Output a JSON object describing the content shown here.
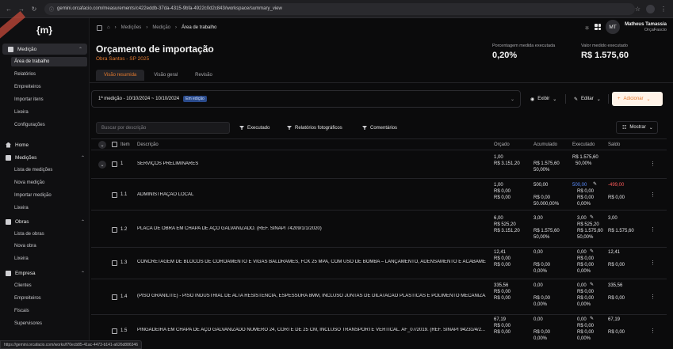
{
  "browser": {
    "url": "gemini.orcafacio.com/measurements/c422eddb-37da-4315-9bfa-4922c0d2c843/workspace/summary_view",
    "status_url": "https://gemini.orcafacio.com/works/f70ecb85-41ac-4473-b141-a626d886346"
  },
  "sidebar": {
    "logo": "{m}",
    "sections": [
      {
        "label": "Medição",
        "items": [
          "Área de trabalho",
          "Relatórios",
          "Empreiteiros",
          "Importar itens",
          "Lixeira",
          "Configurações"
        ]
      },
      {
        "label": "Home",
        "items": []
      },
      {
        "label": "Medições",
        "items": [
          "Lista de medições",
          "Nova medição",
          "Importar medição",
          "Lixeira"
        ]
      },
      {
        "label": "Obras",
        "items": [
          "Lista de obras",
          "Nova obra",
          "Lixeira"
        ]
      },
      {
        "label": "Empresa",
        "items": [
          "Clientes",
          "Empreiteiros",
          "Fiscais",
          "Supervisores"
        ]
      }
    ]
  },
  "topbar": {
    "breadcrumbs": [
      "Medições",
      "Medição",
      "Área de trabalho"
    ],
    "user_initials": "MT",
    "user_name": "Matheus Tamassia",
    "user_org": "OrçaFascio"
  },
  "header": {
    "title": "Orçamento de importação",
    "subtitle": "Obra Santos - SP 2025",
    "metrics": [
      {
        "label": "Porcentagem medida executada",
        "value": "0,20%"
      },
      {
        "label": "Valor medido executado",
        "value": "R$ 1.575,60"
      }
    ],
    "tabs": [
      "Visão resumida",
      "Visão geral",
      "Revisão"
    ]
  },
  "toolbar": {
    "period": "1ª medição - 10/10/2024 ~ 10/10/2024",
    "period_badge": "Em edição",
    "exibir": "Exibir",
    "editar": "Editar",
    "adicionar": "Adicionar"
  },
  "filters": {
    "search_placeholder": "Buscar por descrição",
    "executado": "Executado",
    "relatorios": "Relatórios fotográficos",
    "comentarios": "Comentários",
    "mostrar": "Mostrar"
  },
  "table": {
    "headers": [
      "Item",
      "Descrição",
      "Orçado",
      "Acumulado",
      "Executado",
      "Saldo"
    ],
    "rows": [
      {
        "item": "1",
        "desc": "SERVIÇOS PRELIMINARES",
        "orcado": [
          "1,00",
          "R$ 3.151,20"
        ],
        "acumulado": [
          "",
          "R$ 1.575,60",
          "50,00%"
        ],
        "executado": [
          "R$ 1.575,60",
          "50,00%"
        ],
        "saldo": []
      },
      {
        "item": "1.1",
        "desc": "ADMINISTRAÇÃO LOCAL",
        "orcado": [
          "1,00",
          "R$ 0,00",
          "R$ 0,00"
        ],
        "acumulado": [
          "500,00",
          "R$ 0,00",
          "50.000,00%"
        ],
        "executado": [
          "500,00",
          "R$ 0,00",
          "R$ 0,00",
          "0,00%"
        ],
        "saldo": [
          "-499,00",
          "R$ 0,00"
        ]
      },
      {
        "item": "1.2",
        "desc": "PLACA DE OBRA EM CHAPA DE AÇO GALVANIZADO. (REF. SINAPI 74209/1/1/2020)",
        "orcado": [
          "6,00",
          "R$ 525,20",
          "R$ 3.151,20"
        ],
        "acumulado": [
          "3,00",
          "R$ 1.575,60",
          "50,00%"
        ],
        "executado": [
          "3,00",
          "R$ 525,20",
          "R$ 1.575,60",
          "50,00%"
        ],
        "saldo": [
          "3,00",
          "R$ 1.575,60"
        ]
      },
      {
        "item": "1.3",
        "desc": "CONCRETAGEM DE BLOCOS DE COROAMENTO E VIGAS BALDRAMES, FCK 25 MPA, COM USO DE BOMBA – LANÇAMENTO, ADENSAMENTO E ACABAME...",
        "orcado": [
          "12,41",
          "R$ 0,00",
          "R$ 0,00"
        ],
        "acumulado": [
          "0,00",
          "R$ 0,00",
          "0,00%"
        ],
        "executado": [
          "0,00",
          "R$ 0,00",
          "R$ 0,00",
          "0,00%"
        ],
        "saldo": [
          "12,41",
          "R$ 0,00"
        ]
      },
      {
        "item": "1.4",
        "desc": "(PISO GRANILITE) - PISO INDUSTRIAL DE ALTA RESISTENCIA, ESPESSURA 8MM, INCLUSO JUNTAS DE DILATACAO PLASTICAS E POLIMENTO MECANIZA...",
        "orcado": [
          "335,56",
          "R$ 0,00",
          "R$ 0,00"
        ],
        "acumulado": [
          "0,00",
          "R$ 0,00",
          "0,00%"
        ],
        "executado": [
          "0,00",
          "R$ 0,00",
          "R$ 0,00",
          "0,00%"
        ],
        "saldo": [
          "335,56",
          "R$ 0,00"
        ]
      },
      {
        "item": "1.5",
        "desc": "PINGADEIRA EM CHAPA DE AÇO GALVANIZADO NÚMERO 24, CORTE DE 25 CM, INCLUSO TRANSPORTE VERTICAL. AF_07/2019. (REF. SINAPI 94231/4/2...",
        "orcado": [
          "67,19",
          "R$ 0,00",
          "R$ 0,00"
        ],
        "acumulado": [
          "0,00",
          "R$ 0,00",
          "0,00%"
        ],
        "executado": [
          "0,00",
          "R$ 0,00",
          "R$ 0,00",
          "0,00%"
        ],
        "saldo": [
          "67,19",
          "R$ 0,00"
        ]
      }
    ]
  }
}
